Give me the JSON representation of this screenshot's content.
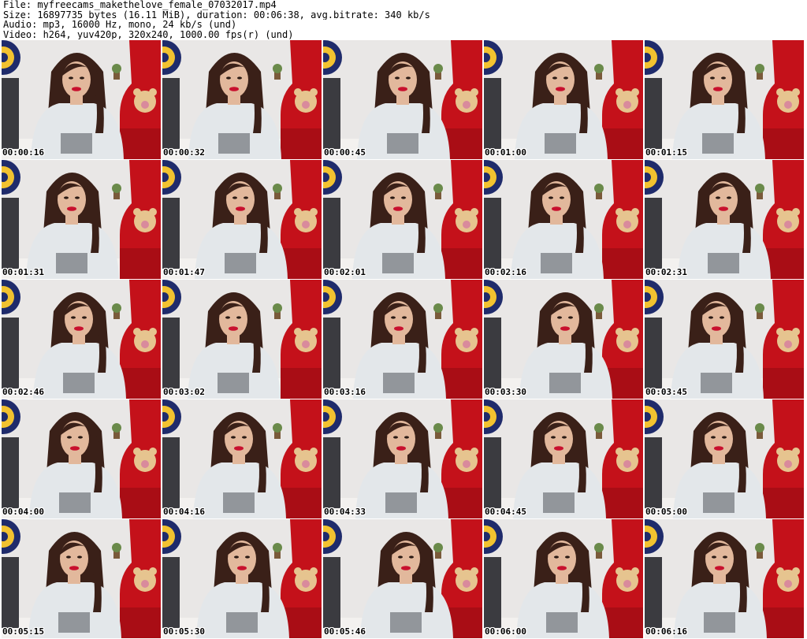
{
  "header": {
    "file_line": "File: myfreecams_makethelove_female_07032017.mp4",
    "size_line": "Size: 16897735 bytes (16.11 MiB), duration: 00:06:38, avg.bitrate: 340 kb/s",
    "audio_line": "Audio: mp3, 16000 Hz, mono, 24 kb/s (und)",
    "video_line": "Video: h264, yuv420p, 320x240, 1000.00 fps(r) (und)"
  },
  "colors": {
    "background": "#ffffff",
    "wall": "#e9e7e6",
    "sofa_red": "#c4111a",
    "shirt": "#e3e7ea",
    "hair": "#3a2018",
    "skin": "#e2b89c",
    "lips": "#c8102e"
  },
  "thumbnails": [
    {
      "time": "00:00:16"
    },
    {
      "time": "00:00:32"
    },
    {
      "time": "00:00:45"
    },
    {
      "time": "00:01:00"
    },
    {
      "time": "00:01:15"
    },
    {
      "time": "00:01:31"
    },
    {
      "time": "00:01:47"
    },
    {
      "time": "00:02:01"
    },
    {
      "time": "00:02:16"
    },
    {
      "time": "00:02:31"
    },
    {
      "time": "00:02:46"
    },
    {
      "time": "00:03:02"
    },
    {
      "time": "00:03:16"
    },
    {
      "time": "00:03:30"
    },
    {
      "time": "00:03:45"
    },
    {
      "time": "00:04:00"
    },
    {
      "time": "00:04:16"
    },
    {
      "time": "00:04:33"
    },
    {
      "time": "00:04:45"
    },
    {
      "time": "00:05:00"
    },
    {
      "time": "00:05:15"
    },
    {
      "time": "00:05:30"
    },
    {
      "time": "00:05:46"
    },
    {
      "time": "00:06:00"
    },
    {
      "time": "00:06:16"
    }
  ]
}
